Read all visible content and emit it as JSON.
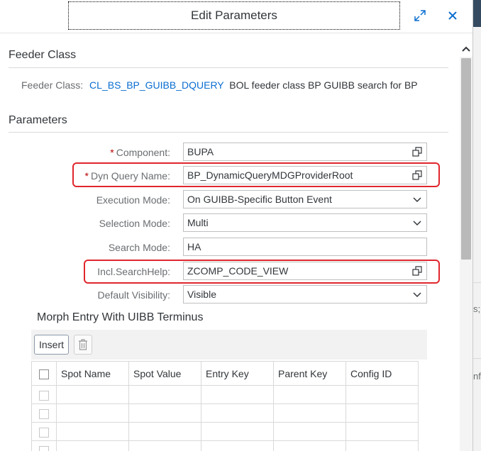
{
  "dialog": {
    "title": "Edit Parameters",
    "icons": [
      "maximize-icon",
      "close-icon"
    ]
  },
  "feeder": {
    "section_title": "Feeder Class",
    "label": "Feeder Class:",
    "class_link": "CL_BS_BP_GUIBB_DQUERY",
    "description": "BOL feeder class BP GUIBB search for BP"
  },
  "parameters": {
    "section_title": "Parameters",
    "fields": [
      {
        "label": "Component:",
        "required": "*",
        "value": "BUPA",
        "control": "value-help",
        "highlighted": false
      },
      {
        "label": "Dyn Query Name:",
        "required": "*",
        "value": "BP_DynamicQueryMDGProviderRoot",
        "control": "value-help",
        "highlighted": true
      },
      {
        "label": "Execution Mode:",
        "required": "",
        "value": "On GUIBB-Specific Button Event",
        "control": "dropdown",
        "highlighted": false
      },
      {
        "label": "Selection Mode:",
        "required": "",
        "value": "Multi",
        "control": "dropdown",
        "highlighted": false
      },
      {
        "label": "Search Mode:",
        "required": "",
        "value": "HA",
        "control": "text",
        "highlighted": false
      },
      {
        "label": "Incl.SearchHelp:",
        "required": "",
        "value": "ZCOMP_CODE_VIEW",
        "control": "value-help",
        "highlighted": true
      },
      {
        "label": "Default Visibility:",
        "required": "",
        "value": "Visible",
        "control": "dropdown",
        "highlighted": false
      }
    ]
  },
  "morph": {
    "title": "Morph Entry With UIBB Terminus",
    "insert_label": "Insert",
    "columns": [
      "Spot Name",
      "Spot Value",
      "Entry Key",
      "Parent Key",
      "Config ID"
    ]
  },
  "background": {
    "fragments": [
      "s;",
      "nfi"
    ]
  },
  "colors": {
    "link": "#0a6ed1",
    "required": "#bb0000",
    "highlight": "#e0262d"
  }
}
